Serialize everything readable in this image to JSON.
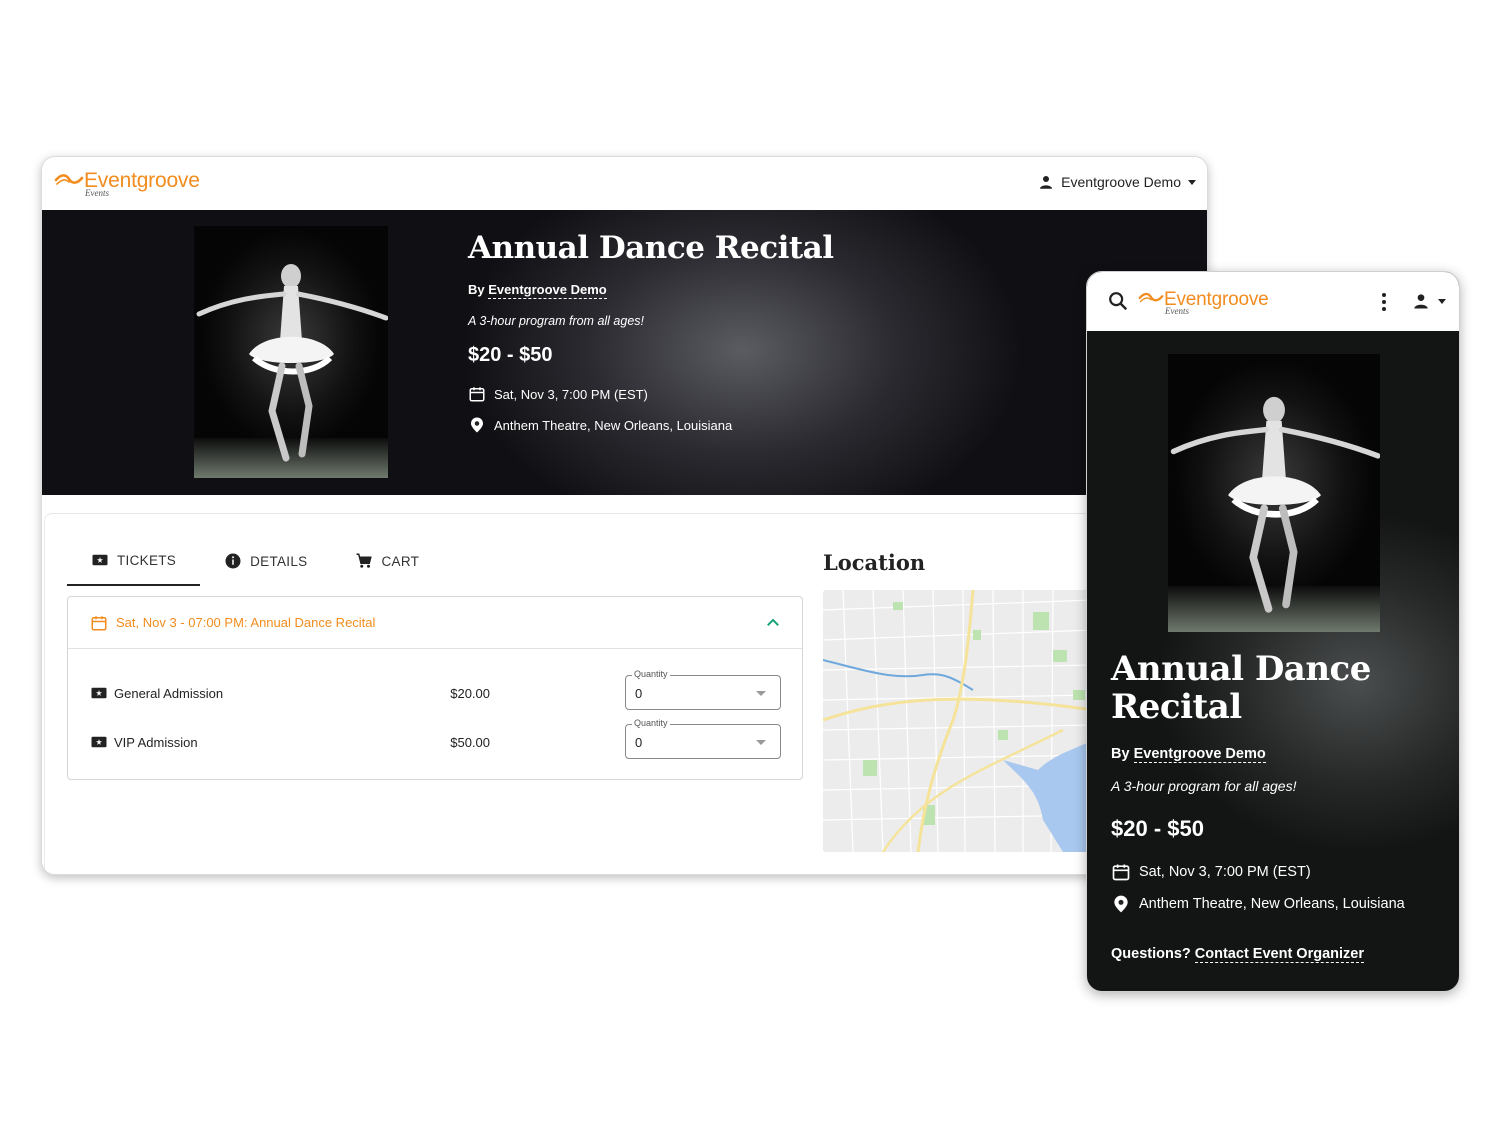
{
  "brand": {
    "name": "Eventgroove",
    "sub": "Events",
    "color": "#f28c1e"
  },
  "desktop": {
    "user_menu_label": "Eventgroove Demo",
    "event": {
      "title": "Annual Dance Recital",
      "by_prefix": "By",
      "organizer": "Eventgroove Demo",
      "tagline": "A 3-hour program from all ages!",
      "price_range": "$20 - $50",
      "date": "Sat, Nov 3, 7:00 PM (EST)",
      "venue": "Anthem Theatre, New Orleans, Louisiana"
    },
    "tabs": [
      {
        "label": "TICKETS",
        "icon": "ticket-icon",
        "active": true
      },
      {
        "label": "DETAILS",
        "icon": "info-icon",
        "active": false
      },
      {
        "label": "CART",
        "icon": "cart-icon",
        "active": false
      }
    ],
    "accordion": {
      "header": "Sat, Nov 3 - 07:00 PM: Annual Dance Recital",
      "tickets": [
        {
          "name": "General Admission",
          "price": "$20.00",
          "qty_label": "Quantity",
          "qty": "0"
        },
        {
          "name": "VIP Admission",
          "price": "$50.00",
          "qty_label": "Quantity",
          "qty": "0"
        }
      ]
    },
    "location_title": "Location"
  },
  "mobile": {
    "event": {
      "title": "Annual Dance Recital",
      "by_prefix": "By",
      "organizer": "Eventgroove Demo",
      "tagline": "A 3-hour program for all ages!",
      "price_range": "$20 - $50",
      "date": "Sat, Nov 3, 7:00 PM (EST)",
      "venue": "Anthem Theatre, New Orleans, Louisiana"
    },
    "questions_prefix": "Questions?",
    "contact_link": "Contact Event Organizer"
  }
}
